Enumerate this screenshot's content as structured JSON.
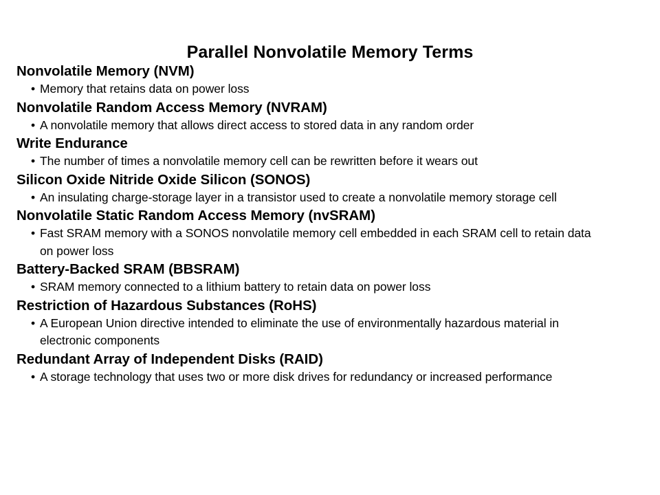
{
  "slide": {
    "title": "Parallel Nonvolatile Memory Terms",
    "bullet_glyph": "•",
    "background_color": "#ffffff",
    "text_color": "#000000",
    "terms": [
      {
        "heading": "Nonvolatile Memory (NVM)",
        "definition": "Memory that retains data on power loss"
      },
      {
        "heading": "Nonvolatile Random Access Memory (NVRAM)",
        "definition": "A nonvolatile memory that allows direct access to stored data in any random order"
      },
      {
        "heading": "Write Endurance",
        "definition": "The number of times a nonvolatile memory cell can be rewritten before it wears out"
      },
      {
        "heading": "Silicon Oxide Nitride Oxide Silicon (SONOS)",
        "definition": "An insulating charge-storage layer in a transistor used to create a nonvolatile memory storage cell"
      },
      {
        "heading": "Nonvolatile Static Random Access Memory (nvSRAM)",
        "definition": "Fast SRAM memory with a SONOS nonvolatile memory cell embedded in each SRAM cell to retain data on power loss"
      },
      {
        "heading": "Battery-Backed SRAM (BBSRAM)",
        "definition": "SRAM memory connected to a lithium battery to retain data on power loss"
      },
      {
        "heading": "Restriction of Hazardous Substances (RoHS)",
        "definition": "A European Union directive intended to eliminate the use of environmentally hazardous material in electronic components"
      },
      {
        "heading": "Redundant Array of Independent Disks (RAID)",
        "definition": "A storage technology that uses two or more disk drives for redundancy or increased performance"
      }
    ]
  }
}
